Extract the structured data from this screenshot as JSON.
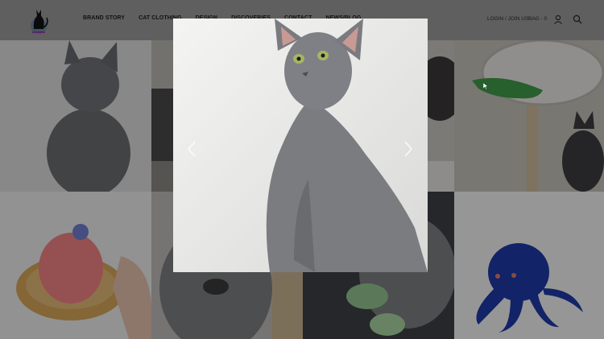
{
  "header": {
    "logo_icon": "black-cat-logo-icon",
    "nav": [
      "BRAND STORY",
      "CAT CLOTHING",
      "DESIGN",
      "DISCOVERIES",
      "CONTACT",
      "NEWS/BLOG"
    ],
    "login_label": "LOGIN / JOIN US",
    "bag_label": "BAG - 0",
    "user_icon": "user-icon",
    "search_icon": "search-icon"
  },
  "gallery": {
    "tiles": [
      "grey-cat-looking-up-photo",
      "cat-scratcher-photo",
      "cat-sleeping-photo",
      "cat-with-plush-photo",
      "crocodile-toy-in-cat-wheel-photo",
      "pink-knitted-apple-toy-photo",
      "grey-cat-closeup-photo",
      "cat-with-green-toy-photo",
      "blue-knitted-octopus-toy-photo"
    ]
  },
  "lightbox": {
    "image": "grey-russian-blue-cat-sitting-photo",
    "prev_icon": "chevron-left-icon",
    "next_icon": "chevron-right-icon"
  },
  "colors": {
    "header_bg": "#9a9a9a",
    "overlay": "rgba(0,0,0,0.38)"
  }
}
